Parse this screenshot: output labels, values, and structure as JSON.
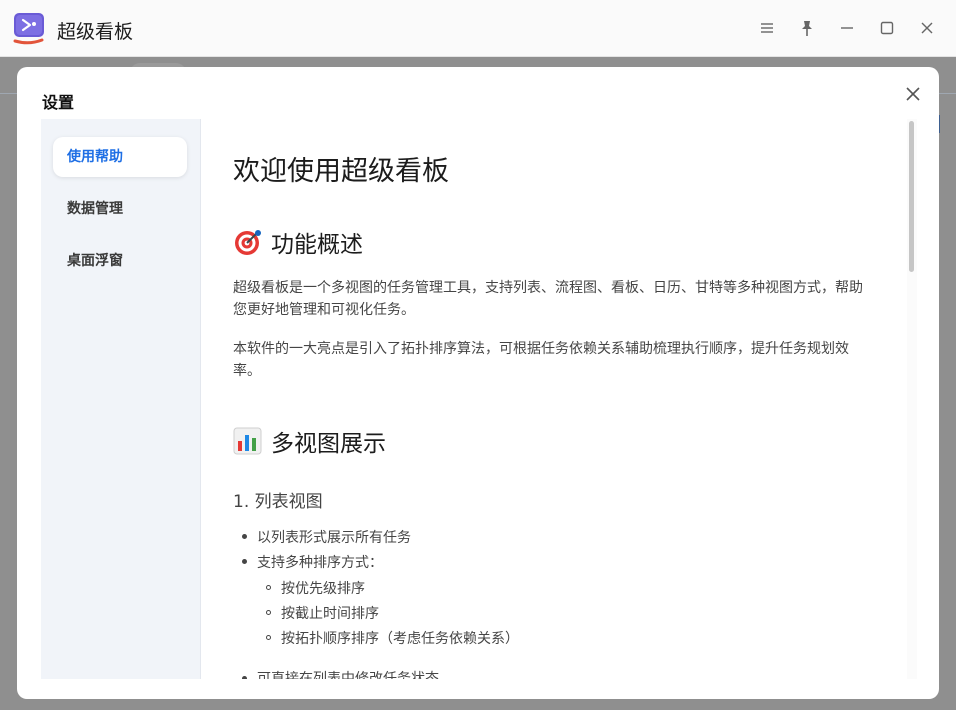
{
  "window": {
    "title": "超级看板",
    "icons": [
      "app-logo-icon",
      "menu-icon",
      "pin-icon",
      "minimize-icon",
      "maximize-icon",
      "close-icon"
    ]
  },
  "dialog": {
    "title": "设置",
    "close_icon": "close-icon"
  },
  "sidebar": {
    "items": [
      {
        "label": "使用帮助",
        "active": true
      },
      {
        "label": "数据管理",
        "active": false
      },
      {
        "label": "桌面浮窗",
        "active": false
      }
    ],
    "active_color": "#1f6fe5"
  },
  "content": {
    "heading": "欢迎使用超级看板",
    "section1": {
      "icon": "target-icon",
      "title": "功能概述",
      "para1": "超级看板是一个多视图的任务管理工具，支持列表、流程图、看板、日历、甘特等多种视图方式，帮助您更好地管理和可视化任务。",
      "para2": "本软件的一大亮点是引入了拓扑排序算法，可根据任务依赖关系辅助梳理执行顺序，提升任务规划效率。"
    },
    "section2": {
      "icon": "bar-chart-icon",
      "title": "多视图展示",
      "subsection1": {
        "title": "1. 列表视图",
        "items": [
          "以列表形式展示所有任务",
          "支持多种排序方式："
        ],
        "subitems": [
          "按优先级排序",
          "按截止时间排序",
          "按拓扑顺序排序（考虑任务依赖关系）"
        ],
        "more_item": "可直接在列表中修改任务状态"
      }
    }
  }
}
